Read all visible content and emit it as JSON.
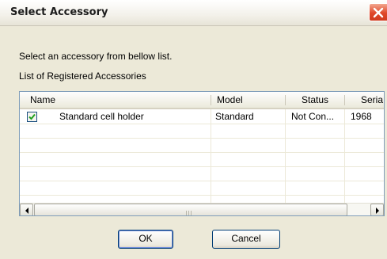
{
  "window": {
    "title": "Select Accessory"
  },
  "intro_text": "Select an accessory from bellow list.",
  "list_label": "List of Registered Accessories",
  "table": {
    "columns": [
      "Name",
      "Model",
      "Status",
      "Seria"
    ],
    "rows": [
      {
        "checked": true,
        "name": "Standard cell holder",
        "model": "Standard",
        "status": "Not Con...",
        "serial": "1968"
      }
    ]
  },
  "buttons": {
    "ok": "OK",
    "cancel": "Cancel"
  },
  "scrollbar": {
    "grip_glyph": "III"
  },
  "colors": {
    "dialog_bg": "#ece9d8",
    "close_button": "#e0482a",
    "list_border": "#7f9db9"
  }
}
